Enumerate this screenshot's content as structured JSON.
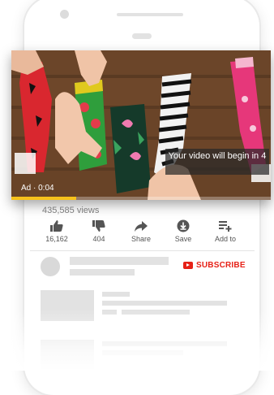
{
  "video": {
    "countdown_text": "Your video will begin in 4",
    "ad_label": "Ad · 0:04",
    "ad_progress": 0.25
  },
  "stats": {
    "views": "435,585 views"
  },
  "actions": [
    {
      "icon": "thumbs-up-icon",
      "label": "16,162"
    },
    {
      "icon": "thumbs-down-icon",
      "label": "404"
    },
    {
      "icon": "share-icon",
      "label": "Share"
    },
    {
      "icon": "save-icon",
      "label": "Save"
    },
    {
      "icon": "add-to-queue-icon",
      "label": "Add to"
    }
  ],
  "channel": {
    "subscribe_label": "SUBSCRIBE",
    "accent": "#e62117"
  },
  "colors": {
    "progress": "#f7c21b",
    "placeholder": "#e2e2e2"
  }
}
